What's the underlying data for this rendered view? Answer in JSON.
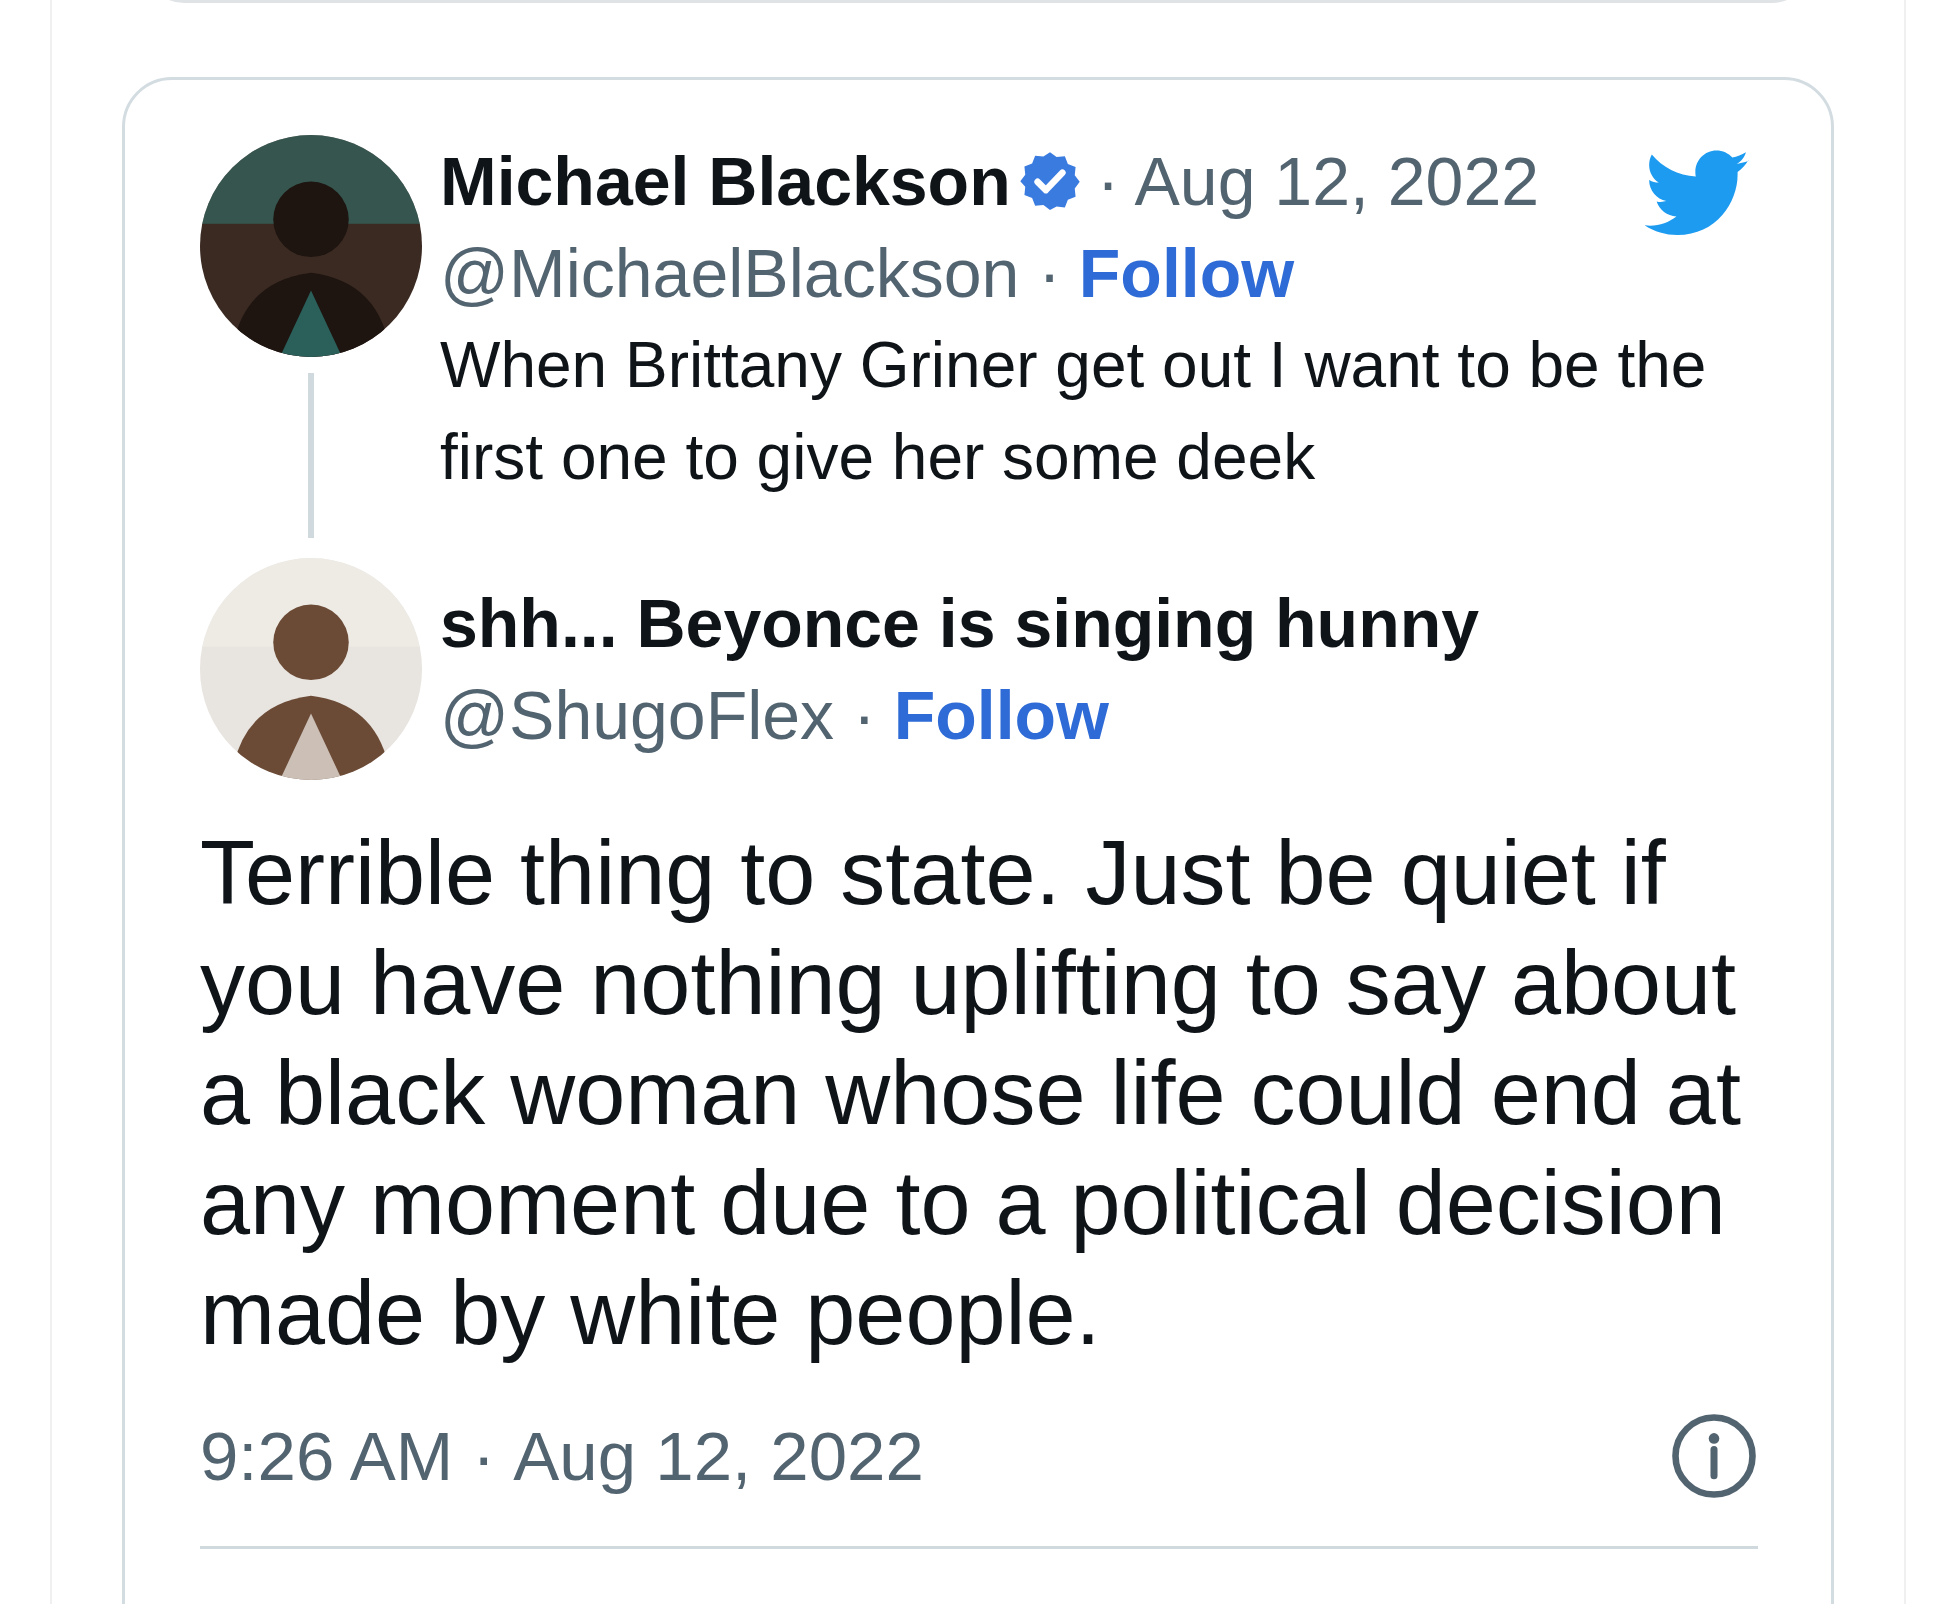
{
  "thread": [
    {
      "name": "Michael Blackson",
      "verified": true,
      "date": "· Aug 12, 2022",
      "handle": "@MichaelBlackson ·",
      "follow": "Follow",
      "text": "When Brittany Griner get out I want to be the first one to give her some deek"
    },
    {
      "name": "shh... Beyonce is singing hunny",
      "verified": false,
      "handle": "@ShugoFlex ·",
      "follow": "Follow"
    }
  ],
  "reply": {
    "text": "Terrible thing to state. Just be quiet if you have nothing uplifting to say about a black woman whose life could end at any moment due to a political decision made by white people.",
    "time": "9:26 AM ·",
    "date": "Aug 12, 2022"
  }
}
